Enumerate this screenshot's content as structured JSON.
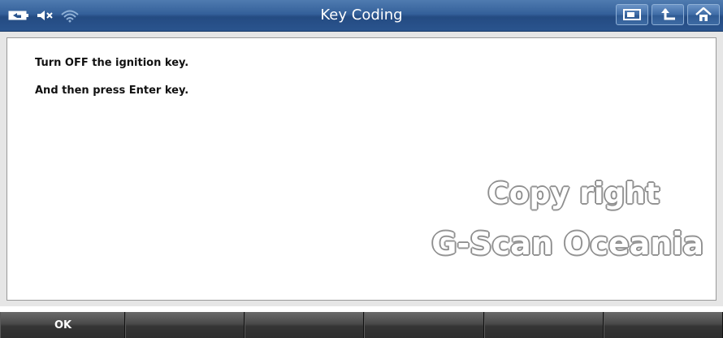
{
  "window": {
    "title": "Key Coding"
  },
  "status_icons": [
    "battery-icon",
    "speaker-mute-icon",
    "wifi-icon"
  ],
  "nav_buttons": [
    "screen-capture-icon",
    "back-icon",
    "home-icon"
  ],
  "message": {
    "line1": "Turn OFF the ignition key.",
    "line2": "And then press Enter key."
  },
  "watermark": {
    "line1": "Copy right",
    "line2": "G-Scan Oceania"
  },
  "function_buttons": [
    "OK",
    "",
    "",
    "",
    "",
    ""
  ],
  "colors": {
    "titlebar": "#2f5b94",
    "function_bar": "#3a3a3a",
    "content_bg": "#ffffff"
  }
}
